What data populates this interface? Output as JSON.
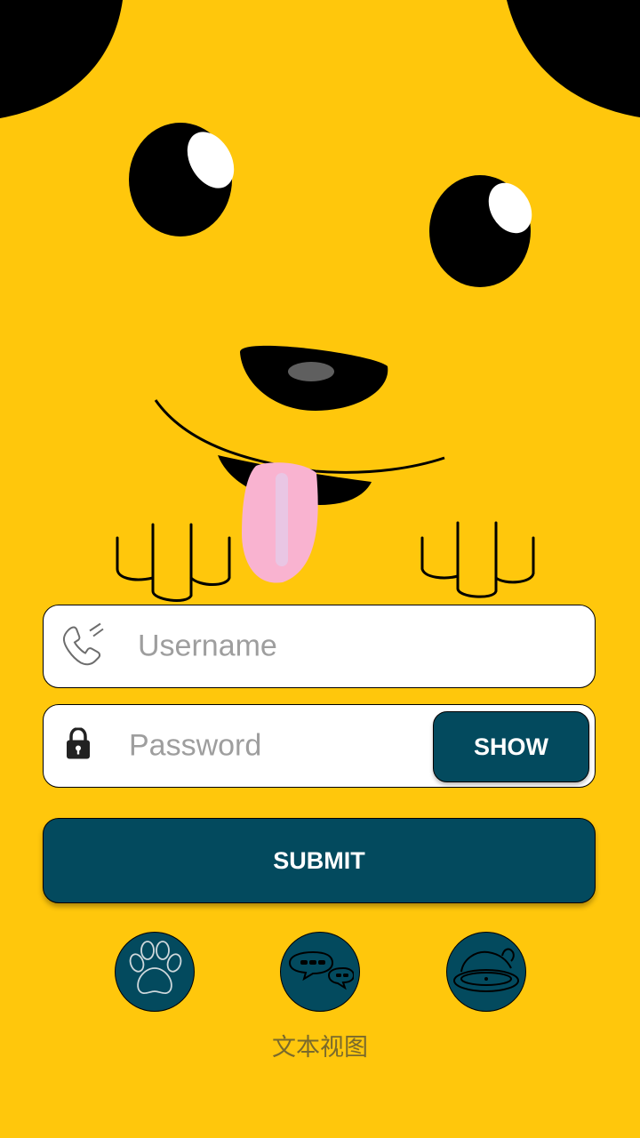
{
  "login": {
    "username_placeholder": "Username",
    "password_placeholder": "Password",
    "show_label": "SHOW",
    "submit_label": "SUBMIT"
  },
  "social": {
    "icons": [
      "paw-icon",
      "chat-bubbles-icon",
      "bowl-icon"
    ]
  },
  "caption": "文本视图",
  "colors": {
    "background": "#FFC70C",
    "button": "#034A5E",
    "tongue": "#F9B3D0"
  },
  "icons": {
    "username": "phone-icon",
    "password": "lock-icon"
  }
}
